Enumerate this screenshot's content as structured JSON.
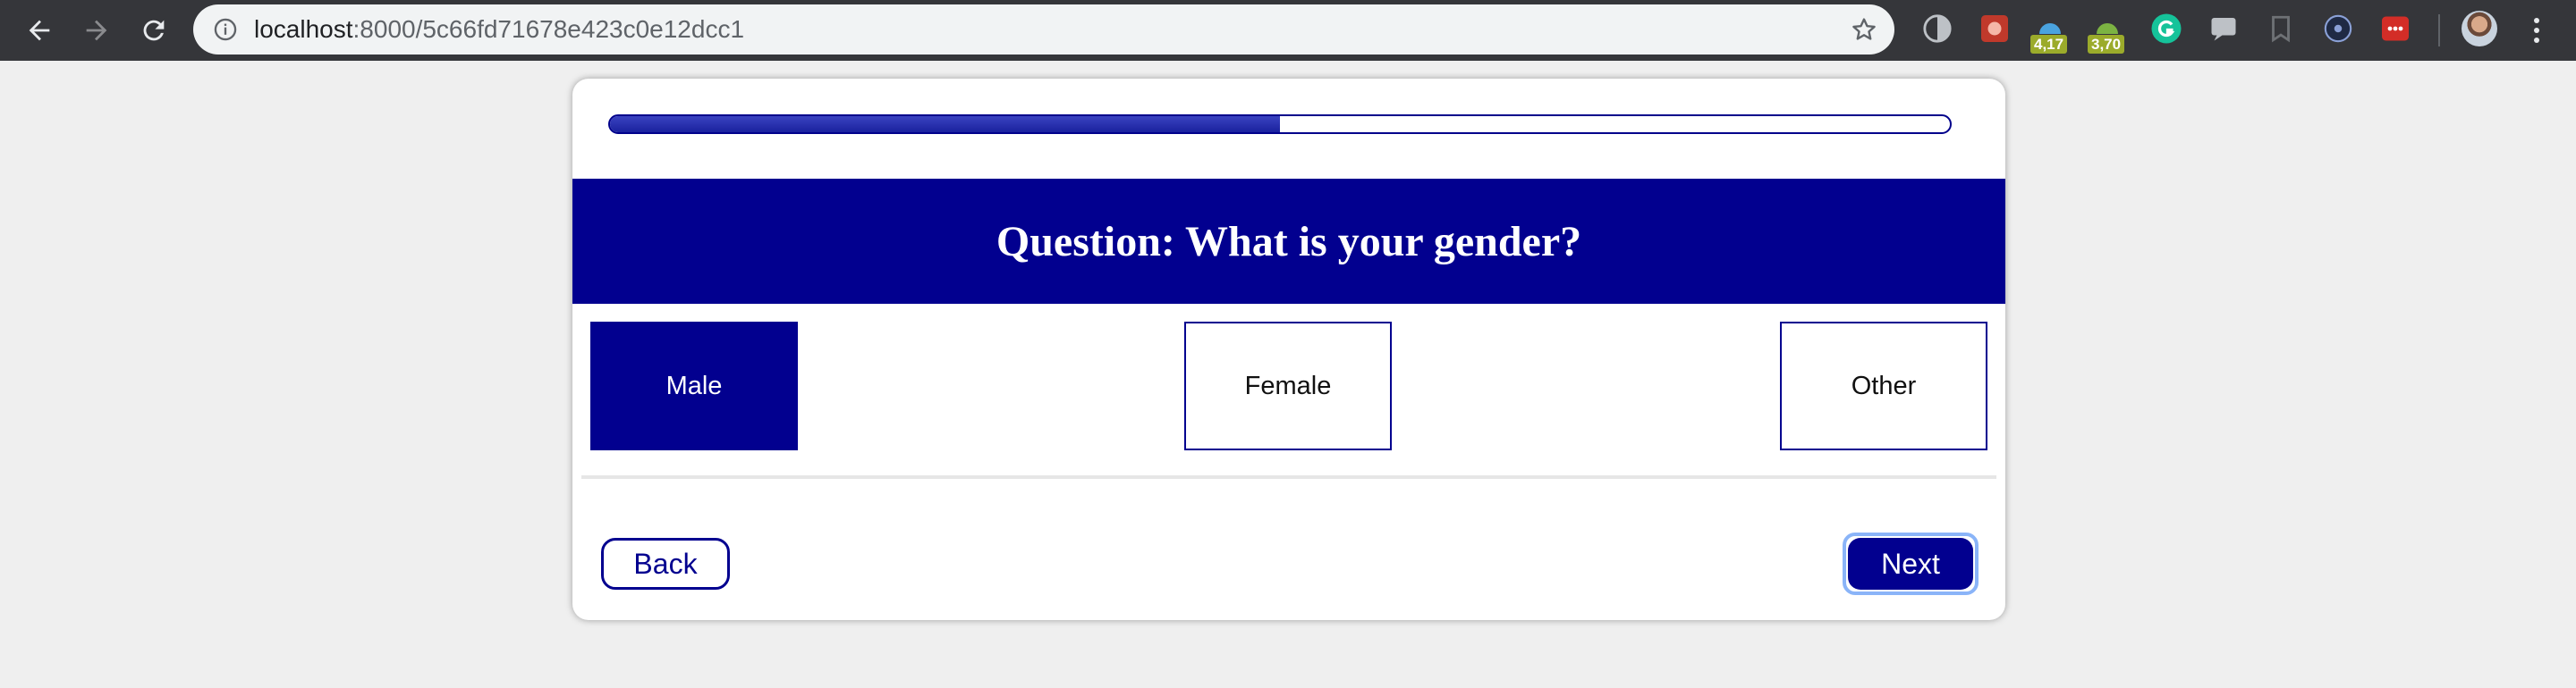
{
  "browser": {
    "url_host": "localhost",
    "url_path": ":8000/5c66fd71678e423c0e12dcc1",
    "extensions": [
      {
        "icon": "contrast-icon"
      },
      {
        "icon": "puzzle-red-icon"
      },
      {
        "icon": "android-blue-icon",
        "badge": "4,17"
      },
      {
        "icon": "android-green-icon",
        "badge": "3,70"
      },
      {
        "icon": "grammarly-icon"
      },
      {
        "icon": "chat-icon"
      },
      {
        "icon": "bookmark-icon"
      },
      {
        "icon": "compass-icon"
      },
      {
        "icon": "lastpass-icon"
      }
    ]
  },
  "survey": {
    "progress": 0.5,
    "question": "Question: What is your gender?",
    "options": [
      {
        "label": "Male",
        "selected": true
      },
      {
        "label": "Female",
        "selected": false
      },
      {
        "label": "Other",
        "selected": false
      }
    ],
    "back_label": "Back",
    "next_label": "Next"
  },
  "colors": {
    "primary": "#02008f",
    "progress_fill": "#2a32b0",
    "focus_ring": "#8ab4f8",
    "chrome": "#35363a",
    "background": "#efefef"
  }
}
